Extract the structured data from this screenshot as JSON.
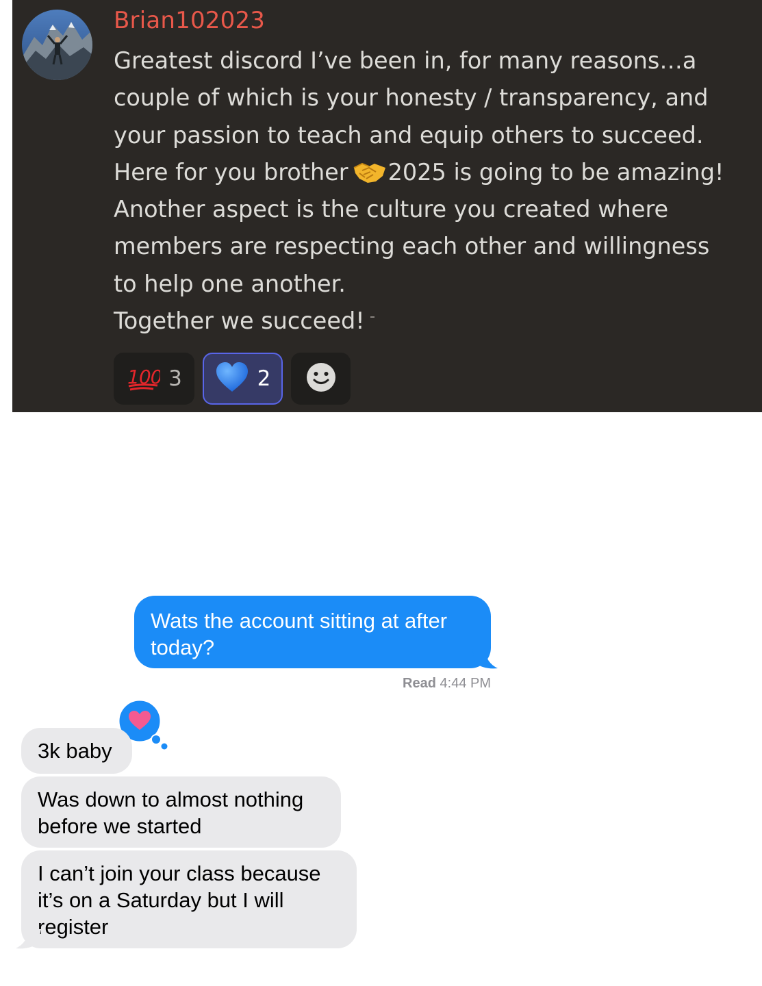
{
  "discord": {
    "username": "Brian102023",
    "message_lines": [
      "Greatest discord I’ve been in, for many reasons…a",
      "couple of which is your honesty / transparency, and",
      "your passion to teach and equip others to succeed.",
      "Here for you brother",
      "2025 is going to be amazing!",
      "Another aspect is the culture you created where",
      "members are respecting each other and willingness",
      "to help one another.",
      "Together we succeed!"
    ],
    "reactions": [
      {
        "icon": "hundred-points-icon",
        "count": "3",
        "selected": false
      },
      {
        "icon": "blue-heart-icon",
        "count": "2",
        "selected": true
      },
      {
        "icon": "add-reaction-icon"
      }
    ],
    "colors": {
      "background": "#2b2825",
      "username": "#e8584a",
      "text": "#dddcd8",
      "selected_reaction_border": "#5965e8"
    }
  },
  "imessage": {
    "outgoing": {
      "text": "Wats the account sitting at after today?",
      "lines": [
        "Wats the account sitting at after",
        "today?"
      ]
    },
    "read_receipt": {
      "label": "Read",
      "time": "4:44 PM"
    },
    "tapback": {
      "icon": "heart-icon"
    },
    "incoming": [
      {
        "lines": [
          "3k baby"
        ]
      },
      {
        "lines": [
          "Was down to almost nothing",
          "before we started"
        ]
      },
      {
        "lines": [
          "I can’t join your class because",
          "it’s on a Saturday but I will",
          "register"
        ]
      }
    ],
    "colors": {
      "outgoing_bubble": "#1b8cf7",
      "incoming_bubble": "#e9e9eb",
      "tapback_heart": "#f55a91"
    }
  }
}
